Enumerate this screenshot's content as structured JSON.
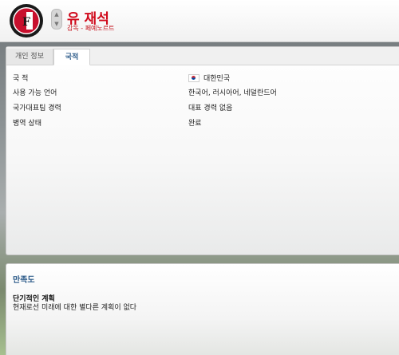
{
  "header": {
    "name": "유 재석",
    "subtitle": "감독 - 페예노르트",
    "club_crest": "feyenoord-crest-icon",
    "nav_up": "▲",
    "nav_down": "▼"
  },
  "tabs": [
    {
      "label": "개인 정보",
      "active": false
    },
    {
      "label": "국적",
      "active": true
    }
  ],
  "details": [
    {
      "label": "국 적",
      "value": "대한민국",
      "icon": "flag-south-korea-icon"
    },
    {
      "label": "사용 가능 언어",
      "value": "한국어, 러시아어, 네덜란드어"
    },
    {
      "label": "국가대표팀 경력",
      "value": "대표 경력 없음"
    },
    {
      "label": "병역 상태",
      "value": "완료"
    }
  ],
  "satisfaction": {
    "title": "만족도",
    "plan_heading": "단기적인 계획",
    "plan_text": "현재로선 미래에 대한 별다른 계획이 없다"
  },
  "colors": {
    "name_red": "#d0081a",
    "section_blue": "#2e5c8a"
  }
}
